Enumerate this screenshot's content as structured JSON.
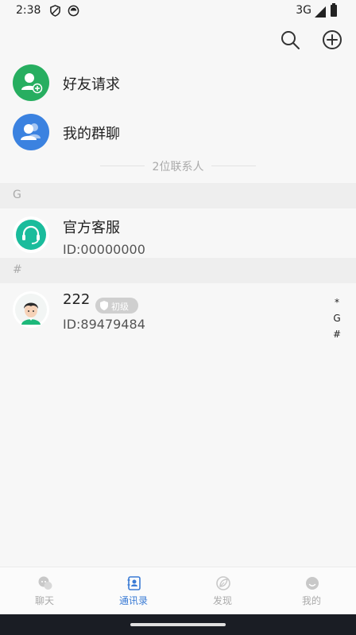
{
  "status_bar": {
    "time": "2:38",
    "network": "3G"
  },
  "contacts_page": {
    "friend_requests_label": "好友请求",
    "my_groups_label": "我的群聊",
    "contact_count": "2位联系人"
  },
  "sections": [
    {
      "letter": "G",
      "contacts": [
        {
          "name": "官方客服",
          "id": "ID:00000000"
        }
      ]
    },
    {
      "letter": "#",
      "contacts": [
        {
          "name": "222",
          "badge": "初级",
          "id": "ID:89479484"
        }
      ]
    }
  ],
  "index_bar": [
    "*",
    "G",
    "#"
  ],
  "tabs": [
    {
      "label": "聊天",
      "icon": "chat-icon",
      "active": false
    },
    {
      "label": "通讯录",
      "icon": "contacts-icon",
      "active": true
    },
    {
      "label": "发现",
      "icon": "discover-icon",
      "active": false
    },
    {
      "label": "我的",
      "icon": "profile-icon",
      "active": false
    }
  ],
  "colors": {
    "friend_request_green": "#27ae60",
    "group_blue": "#3b82e0",
    "service_teal": "#1abc9c",
    "active_tab": "#3a7bd5"
  }
}
